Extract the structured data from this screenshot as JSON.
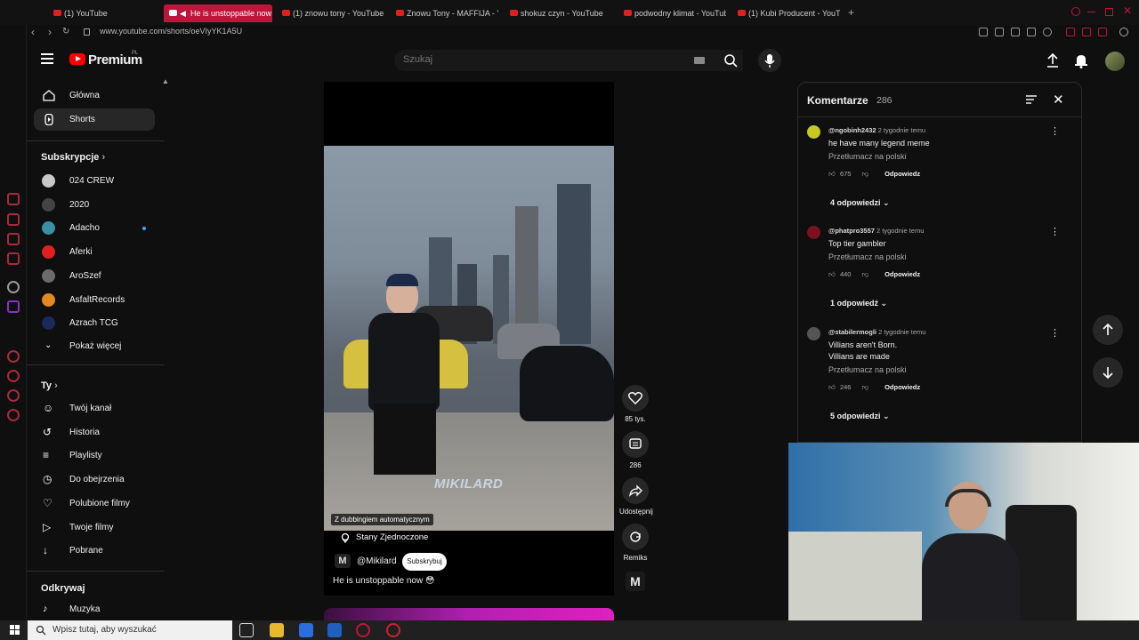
{
  "browser": {
    "tabs": [
      {
        "label": "(1) YouTube"
      },
      {
        "label": "He is unstoppable now",
        "active": true
      },
      {
        "label": "(1) znowu tony - YouTube"
      },
      {
        "label": "Znowu Tony - MAFFIJA - Y"
      },
      {
        "label": "shokuz czyn - YouTube"
      },
      {
        "label": "podwodny klimat - YouTube"
      },
      {
        "label": "(1) Kubi Producent - YouTube"
      }
    ],
    "url": "www.youtube.com/shorts/oeVIyYK1A5U"
  },
  "header": {
    "logo_text": "Premium",
    "logo_region": "PL",
    "search_placeholder": "Szukaj"
  },
  "sidebar": {
    "main": [
      {
        "label": "Główna",
        "icon": "home-icon"
      },
      {
        "label": "Shorts",
        "icon": "shorts-icon",
        "active": true
      }
    ],
    "subs_title": "Subskrypcje",
    "subscriptions": [
      {
        "label": "024 CREW",
        "color": "#c9c9c9"
      },
      {
        "label": "2020",
        "color": "#444444"
      },
      {
        "label": "Adacho",
        "color": "#3a8ea6",
        "new": true
      },
      {
        "label": "Aferki",
        "color": "#e02020"
      },
      {
        "label": "AroSzef",
        "color": "#6b6b6b"
      },
      {
        "label": "AsfaltRecords",
        "color": "#e08a20"
      },
      {
        "label": "Azrach TCG",
        "color": "#1a2a5a"
      }
    ],
    "show_more": "Pokaż więcej",
    "you_title": "Ty",
    "you_items": [
      {
        "label": "Twój kanał",
        "icon": "user-icon"
      },
      {
        "label": "Historia",
        "icon": "history-icon"
      },
      {
        "label": "Playlisty",
        "icon": "playlist-icon"
      },
      {
        "label": "Do obejrzenia",
        "icon": "clock-icon"
      },
      {
        "label": "Polubione filmy",
        "icon": "like-icon"
      },
      {
        "label": "Twoje filmy",
        "icon": "video-icon"
      },
      {
        "label": "Pobrane",
        "icon": "download-icon"
      }
    ],
    "explore_title": "Odkrywaj",
    "explore_items": [
      {
        "label": "Muzyka",
        "icon": "music-icon"
      }
    ]
  },
  "video": {
    "watermark": "MIKILARD",
    "dub_badge": "Z dubbingiem automatycznym",
    "location": "Stany Zjednoczone",
    "channel": "@Mikilard",
    "channel_logo": "M",
    "subscribe": "Subskrybuj",
    "title": "He is unstoppable now 😳"
  },
  "actions": {
    "likes": "85 tys.",
    "comments": "286",
    "share": "Udostępnij",
    "remix": "Remiks"
  },
  "comments": {
    "title": "Komentarze",
    "count": "286",
    "translate": "Przetłumacz na polski",
    "reply": "Odpowiedz",
    "items": [
      {
        "author": "@ngobinh2432",
        "time": "2 tygodnie temu",
        "text": "he have many legend meme",
        "likes": "675",
        "replies": "4 odpowiedzi",
        "color": "#c8c820"
      },
      {
        "author": "@phatpro3557",
        "time": "2 tygodnie temu",
        "text": "Top tier gambler",
        "likes": "440",
        "replies": "1 odpowiedź",
        "color": "#7a1020"
      },
      {
        "author": "@stabilermogli",
        "time": "2 tygodnie temu",
        "text": "Villians aren't Born.\nVillians are made",
        "likes": "246",
        "replies": "5 odpowiedzi",
        "color": "#555555"
      }
    ]
  },
  "taskbar": {
    "search_placeholder": "Wpisz tutaj, aby wyszukać"
  }
}
